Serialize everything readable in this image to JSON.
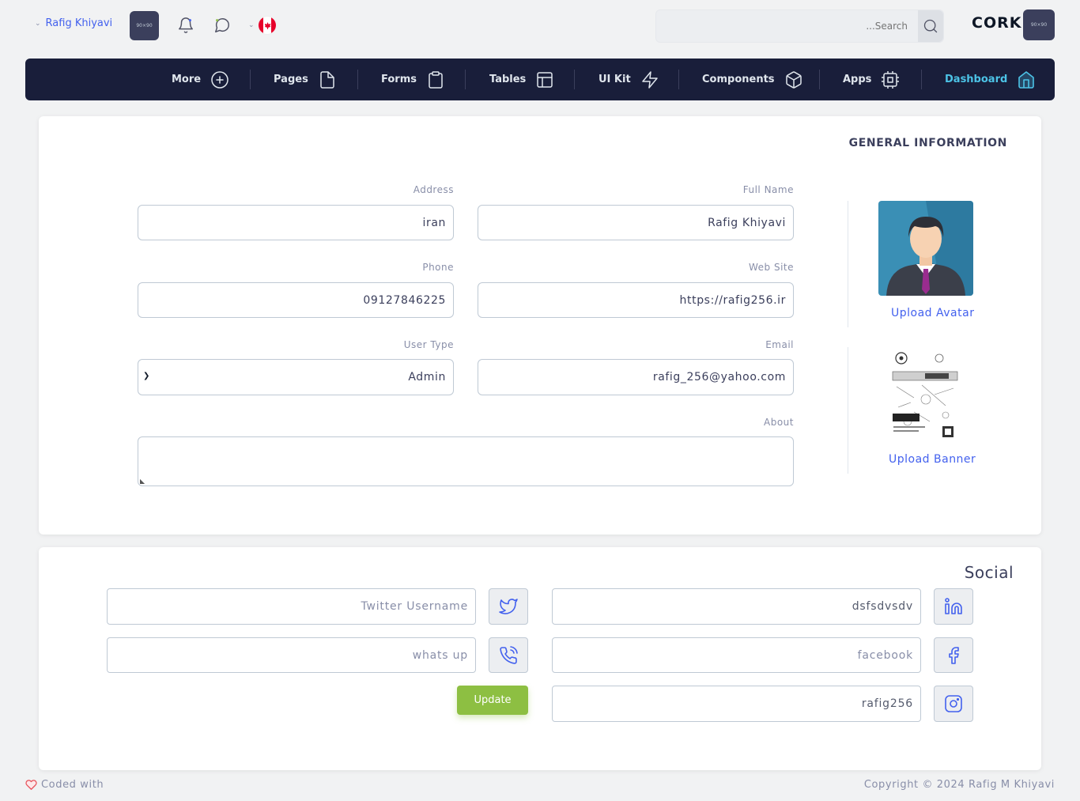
{
  "header": {
    "user_name": "Rafig Khiyavi",
    "avatar_text": "90×90",
    "search_placeholder": "...Search",
    "brand": "CORK",
    "logo_text": "90×90"
  },
  "nav": {
    "items": [
      {
        "label": "More",
        "icon": "plus-circle-icon"
      },
      {
        "label": "Pages",
        "icon": "file-icon"
      },
      {
        "label": "Forms",
        "icon": "clipboard-icon"
      },
      {
        "label": "Tables",
        "icon": "layout-icon"
      },
      {
        "label": "UI Kit",
        "icon": "zap-icon"
      },
      {
        "label": "Components",
        "icon": "box-icon"
      },
      {
        "label": "Apps",
        "icon": "cpu-icon"
      },
      {
        "label": "Dashboard",
        "icon": "home-icon",
        "active": true
      }
    ]
  },
  "general": {
    "title": "GENERAL INFORMATION",
    "address_label": "Address",
    "address_value": "iran",
    "fullname_label": "Full Name",
    "fullname_value": "Rafig Khiyavi",
    "phone_label": "Phone",
    "phone_value": "09127846225",
    "website_label": "Web Site",
    "website_value": "https://rafig256.ir",
    "usertype_label": "User Type",
    "usertype_value": "Admin",
    "email_label": "Email",
    "email_value": "rafig_256@yahoo.com",
    "about_label": "About",
    "about_value": "",
    "upload_avatar": "Upload Avatar",
    "upload_banner": "Upload Banner"
  },
  "social": {
    "title": "Social",
    "twitter_placeholder": "Twitter Username",
    "whatsapp_placeholder": "whats up",
    "linkedin_value": "dsfsdvsdv",
    "facebook_placeholder": "facebook",
    "instagram_value": "rafig256",
    "update_label": "Update"
  },
  "footer": {
    "left": "Coded with",
    "right": "Copyright © 2024 Rafig M Khiyavi"
  },
  "colors": {
    "nav_bg": "#191e3a",
    "accent": "#4361ee",
    "active": "#4cc3e6",
    "success": "#8dbf42",
    "heart": "#e7515a"
  }
}
